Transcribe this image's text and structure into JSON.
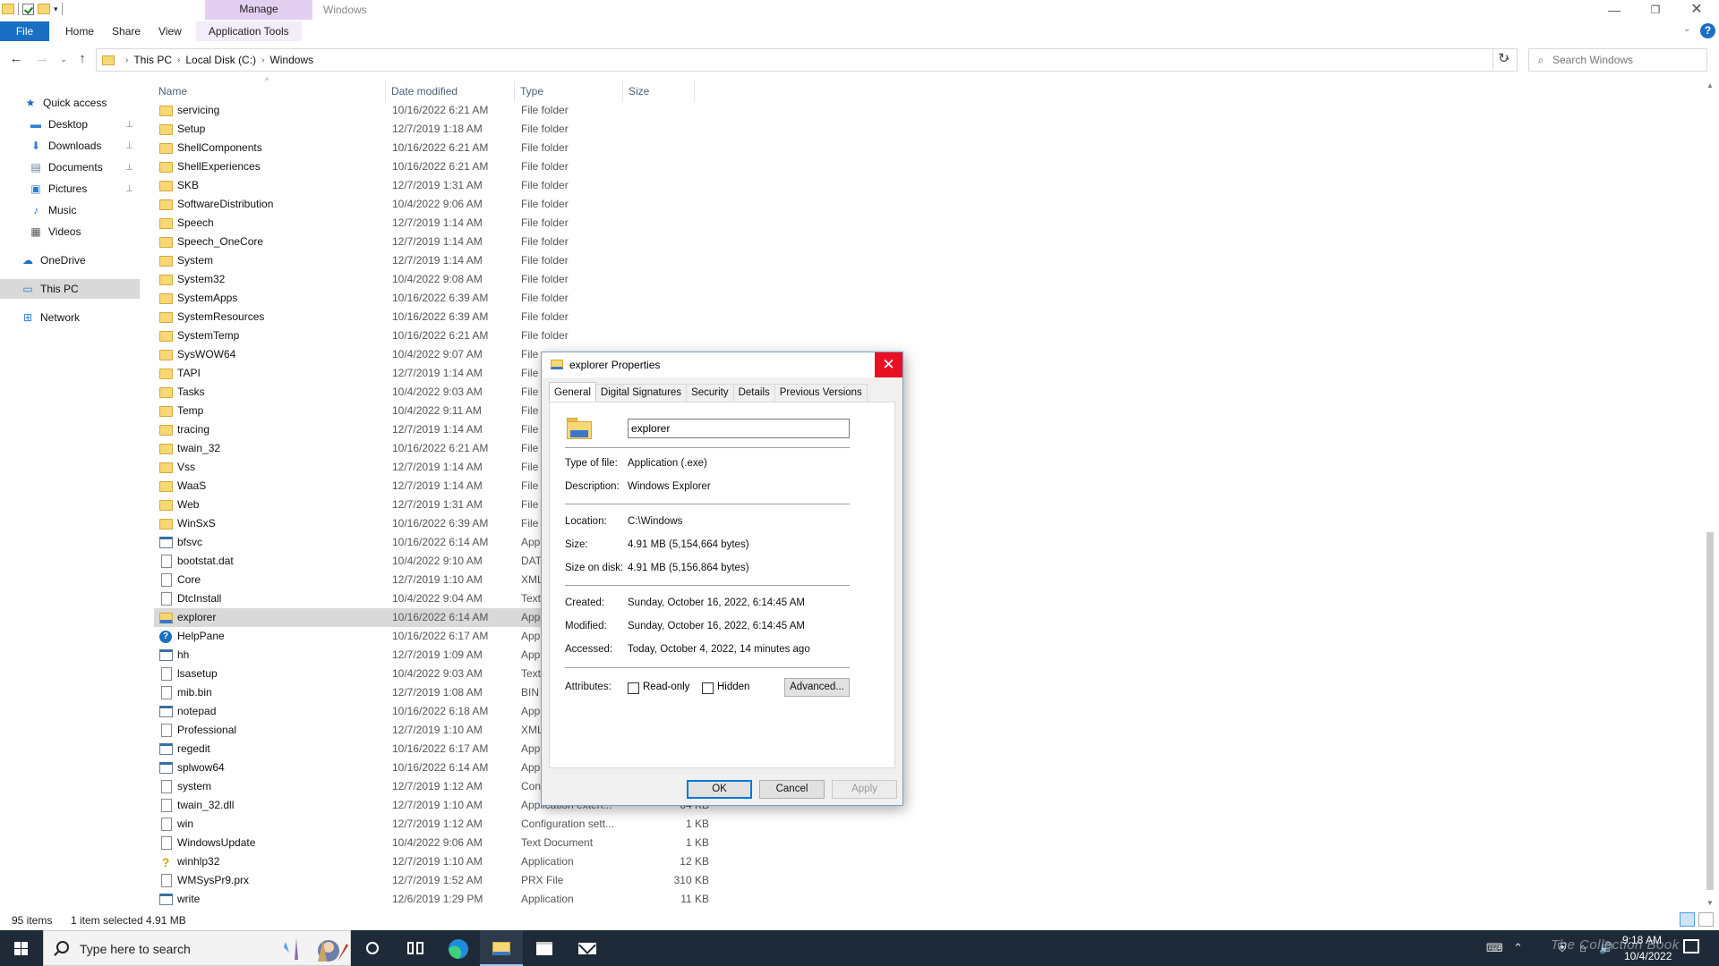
{
  "window": {
    "title": "Windows",
    "manage_tab": "Manage",
    "minimize_glyph": "—",
    "restore_glyph": "❐",
    "close_glyph": "✕"
  },
  "ribbon": {
    "file_tab": "File",
    "tabs": [
      "Home",
      "Share",
      "View"
    ],
    "app_tools_tab": "Application Tools",
    "help_glyph": "?",
    "expand_glyph": "⌄"
  },
  "address": {
    "crumbs": [
      "This PC",
      "Local Disk (C:)",
      "Windows"
    ],
    "back_glyph": "←",
    "forward_glyph": "→",
    "recent_glyph": "⌄",
    "up_glyph": "↑",
    "dropdown_glyph": "⌄",
    "refresh_glyph": "↻",
    "search_placeholder": "Search Windows",
    "search_glyph": "⌕"
  },
  "nav": {
    "items": [
      {
        "label": "Quick access",
        "icon": "star-icon",
        "glyph": "★",
        "color": "#1a6fc4"
      },
      {
        "label": "Desktop",
        "icon": "desktop-icon",
        "glyph": "▬",
        "color": "#2b7fd3",
        "pinned": true
      },
      {
        "label": "Downloads",
        "icon": "downloads-icon",
        "glyph": "⬇",
        "color": "#2b7fd3",
        "pinned": true
      },
      {
        "label": "Documents",
        "icon": "documents-icon",
        "glyph": "▤",
        "color": "#6b7c93",
        "pinned": true
      },
      {
        "label": "Pictures",
        "icon": "pictures-icon",
        "glyph": "▣",
        "color": "#2b7fd3",
        "pinned": true
      },
      {
        "label": "Music",
        "icon": "music-icon",
        "glyph": "♪",
        "color": "#2b7fd3"
      },
      {
        "label": "Videos",
        "icon": "videos-icon",
        "glyph": "▦",
        "color": "#555"
      },
      {
        "label": "OneDrive",
        "icon": "onedrive-icon",
        "glyph": "☁",
        "color": "#1a6fc4"
      },
      {
        "label": "This PC",
        "icon": "this-pc-icon",
        "glyph": "▭",
        "color": "#2b7fd3"
      },
      {
        "label": "Network",
        "icon": "network-icon",
        "glyph": "⊞",
        "color": "#2b7fd3"
      }
    ],
    "pin_glyph": "📌"
  },
  "columns": {
    "name": "Name",
    "date": "Date modified",
    "type": "Type",
    "size": "Size",
    "sort_glyph": "^"
  },
  "files": [
    {
      "name": "servicing",
      "date": "10/16/2022 6:21 AM",
      "type": "File folder",
      "size": "",
      "icon": "folder"
    },
    {
      "name": "Setup",
      "date": "12/7/2019 1:18 AM",
      "type": "File folder",
      "size": "",
      "icon": "folder"
    },
    {
      "name": "ShellComponents",
      "date": "10/16/2022 6:21 AM",
      "type": "File folder",
      "size": "",
      "icon": "folder"
    },
    {
      "name": "ShellExperiences",
      "date": "10/16/2022 6:21 AM",
      "type": "File folder",
      "size": "",
      "icon": "folder"
    },
    {
      "name": "SKB",
      "date": "12/7/2019 1:31 AM",
      "type": "File folder",
      "size": "",
      "icon": "folder"
    },
    {
      "name": "SoftwareDistribution",
      "date": "10/4/2022 9:06 AM",
      "type": "File folder",
      "size": "",
      "icon": "folder"
    },
    {
      "name": "Speech",
      "date": "12/7/2019 1:14 AM",
      "type": "File folder",
      "size": "",
      "icon": "folder"
    },
    {
      "name": "Speech_OneCore",
      "date": "12/7/2019 1:14 AM",
      "type": "File folder",
      "size": "",
      "icon": "folder"
    },
    {
      "name": "System",
      "date": "12/7/2019 1:14 AM",
      "type": "File folder",
      "size": "",
      "icon": "folder"
    },
    {
      "name": "System32",
      "date": "10/4/2022 9:08 AM",
      "type": "File folder",
      "size": "",
      "icon": "folder"
    },
    {
      "name": "SystemApps",
      "date": "10/16/2022 6:39 AM",
      "type": "File folder",
      "size": "",
      "icon": "folder"
    },
    {
      "name": "SystemResources",
      "date": "10/16/2022 6:39 AM",
      "type": "File folder",
      "size": "",
      "icon": "folder"
    },
    {
      "name": "SystemTemp",
      "date": "10/16/2022 6:21 AM",
      "type": "File folder",
      "size": "",
      "icon": "folder"
    },
    {
      "name": "SysWOW64",
      "date": "10/4/2022 9:07 AM",
      "type": "File",
      "size": "",
      "icon": "folder"
    },
    {
      "name": "TAPI",
      "date": "12/7/2019 1:14 AM",
      "type": "File",
      "size": "",
      "icon": "folder"
    },
    {
      "name": "Tasks",
      "date": "10/4/2022 9:03 AM",
      "type": "File",
      "size": "",
      "icon": "folder"
    },
    {
      "name": "Temp",
      "date": "10/4/2022 9:11 AM",
      "type": "File",
      "size": "",
      "icon": "folder"
    },
    {
      "name": "tracing",
      "date": "12/7/2019 1:14 AM",
      "type": "File",
      "size": "",
      "icon": "folder"
    },
    {
      "name": "twain_32",
      "date": "10/16/2022 6:21 AM",
      "type": "File",
      "size": "",
      "icon": "folder"
    },
    {
      "name": "Vss",
      "date": "12/7/2019 1:14 AM",
      "type": "File",
      "size": "",
      "icon": "folder"
    },
    {
      "name": "WaaS",
      "date": "12/7/2019 1:14 AM",
      "type": "File",
      "size": "",
      "icon": "folder"
    },
    {
      "name": "Web",
      "date": "12/7/2019 1:31 AM",
      "type": "File",
      "size": "",
      "icon": "folder"
    },
    {
      "name": "WinSxS",
      "date": "10/16/2022 6:39 AM",
      "type": "File",
      "size": "",
      "icon": "folder"
    },
    {
      "name": "bfsvc",
      "date": "10/16/2022 6:14 AM",
      "type": "App",
      "size": "",
      "icon": "app"
    },
    {
      "name": "bootstat.dat",
      "date": "10/4/2022 9:10 AM",
      "type": "DAT",
      "size": "",
      "icon": "file"
    },
    {
      "name": "Core",
      "date": "12/7/2019 1:10 AM",
      "type": "XML",
      "size": "",
      "icon": "file"
    },
    {
      "name": "DtcInstall",
      "date": "10/4/2022 9:04 AM",
      "type": "Text",
      "size": "",
      "icon": "file"
    },
    {
      "name": "explorer",
      "date": "10/16/2022 6:14 AM",
      "type": "Appl",
      "size": "",
      "icon": "explorer",
      "selected": true
    },
    {
      "name": "HelpPane",
      "date": "10/16/2022 6:17 AM",
      "type": "App",
      "size": "",
      "icon": "help"
    },
    {
      "name": "hh",
      "date": "12/7/2019 1:09 AM",
      "type": "App",
      "size": "",
      "icon": "app"
    },
    {
      "name": "lsasetup",
      "date": "10/4/2022 9:03 AM",
      "type": "Text",
      "size": "",
      "icon": "file"
    },
    {
      "name": "mib.bin",
      "date": "12/7/2019 1:08 AM",
      "type": "BIN",
      "size": "",
      "icon": "file"
    },
    {
      "name": "notepad",
      "date": "10/16/2022 6:18 AM",
      "type": "App",
      "size": "",
      "icon": "app"
    },
    {
      "name": "Professional",
      "date": "12/7/2019 1:10 AM",
      "type": "XML",
      "size": "",
      "icon": "file"
    },
    {
      "name": "regedit",
      "date": "10/16/2022 6:17 AM",
      "type": "App",
      "size": "",
      "icon": "app"
    },
    {
      "name": "splwow64",
      "date": "10/16/2022 6:14 AM",
      "type": "App",
      "size": "",
      "icon": "app"
    },
    {
      "name": "system",
      "date": "12/7/2019 1:12 AM",
      "type": "Con",
      "size": "",
      "icon": "file"
    },
    {
      "name": "twain_32.dll",
      "date": "12/7/2019 1:10 AM",
      "type": "Application exten...",
      "size": "64 KB",
      "icon": "file"
    },
    {
      "name": "win",
      "date": "12/7/2019 1:12 AM",
      "type": "Configuration sett...",
      "size": "1 KB",
      "icon": "file"
    },
    {
      "name": "WindowsUpdate",
      "date": "10/4/2022 9:06 AM",
      "type": "Text Document",
      "size": "1 KB",
      "icon": "file"
    },
    {
      "name": "winhlp32",
      "date": "12/7/2019 1:10 AM",
      "type": "Application",
      "size": "12 KB",
      "icon": "bulb"
    },
    {
      "name": "WMSysPr9.prx",
      "date": "12/7/2019 1:52 AM",
      "type": "PRX File",
      "size": "310 KB",
      "icon": "file"
    },
    {
      "name": "write",
      "date": "12/6/2019 1:29 PM",
      "type": "Application",
      "size": "11 KB",
      "icon": "app"
    }
  ],
  "status": {
    "count": "95 items",
    "selection": "1 item selected  4.91 MB"
  },
  "dialog": {
    "title": "explorer Properties",
    "close_glyph": "✕",
    "tabs": [
      "General",
      "Digital Signatures",
      "Security",
      "Details",
      "Previous Versions"
    ],
    "active_tab": "General",
    "file_name": "explorer",
    "type_label": "Type of file:",
    "type_value": "Application (.exe)",
    "desc_label": "Description:",
    "desc_value": "Windows Explorer",
    "location_label": "Location:",
    "location_value": "C:\\Windows",
    "size_label": "Size:",
    "size_value": "4.91 MB (5,154,664 bytes)",
    "disk_label": "Size on disk:",
    "disk_value": "4.91 MB (5,156,864 bytes)",
    "created_label": "Created:",
    "created_value": "Sunday, October 16, 2022, 6:14:45 AM",
    "modified_label": "Modified:",
    "modified_value": "Sunday, October 16, 2022, 6:14:45 AM",
    "accessed_label": "Accessed:",
    "accessed_value": "Today, October 4, 2022, 14 minutes ago",
    "attributes_label": "Attributes:",
    "readonly_label": "Read-only",
    "hidden_label": "Hidden",
    "advanced_label": "Advanced...",
    "ok_label": "OK",
    "cancel_label": "Cancel",
    "apply_label": "Apply"
  },
  "taskbar": {
    "search_text": "Type here to search",
    "time": "9:18 AM",
    "date": "10/4/2022",
    "watermark": "The Collection Book",
    "tray_glyphs": [
      "⌨",
      "⌃",
      "⛨",
      "⌂",
      "🔊"
    ]
  }
}
